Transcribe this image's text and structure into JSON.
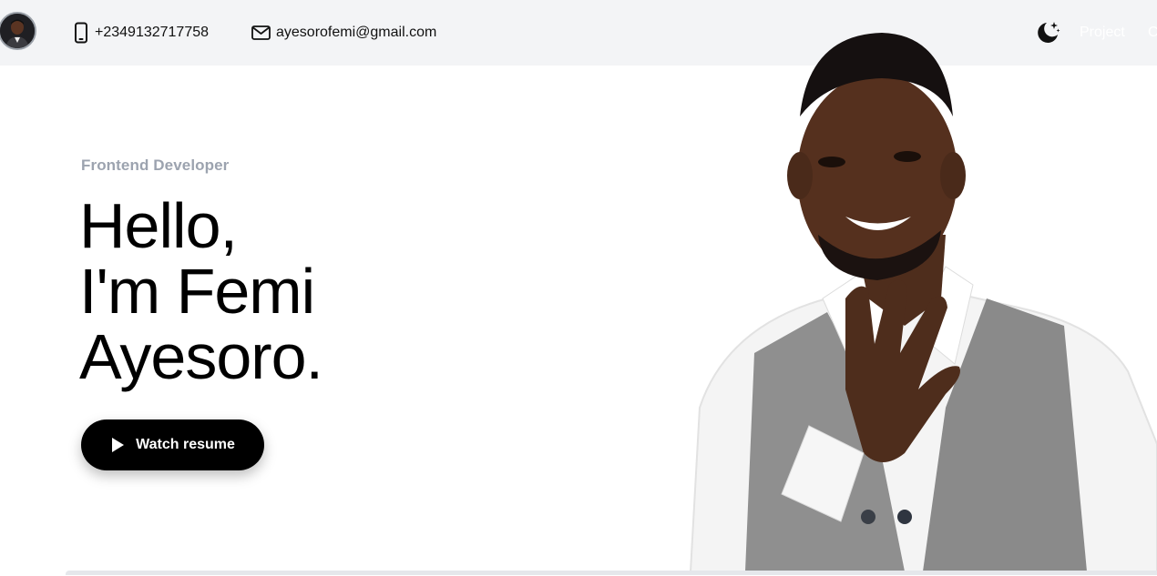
{
  "header": {
    "phone": "+2349132717758",
    "email": "ayesorofemi@gmail.com",
    "nav": [
      {
        "label": "Project"
      },
      {
        "label": "C"
      }
    ],
    "icons": {
      "avatar": "avatar",
      "phone": "phone-icon",
      "email": "mail-icon",
      "theme": "moon-stars-icon"
    }
  },
  "hero": {
    "role": "Frontend Developer",
    "headline": [
      "Hello,",
      "I'm Femi",
      "Ayesoro."
    ],
    "cta_label": "Watch resume",
    "cta_icon": "play-icon"
  },
  "colors": {
    "topbar_bg": "#f3f4f6",
    "role_text": "#9ca3af",
    "cta_bg": "#000000",
    "cta_text": "#ffffff",
    "vest": "#8d8d8d",
    "skin": "#4a2a1a"
  }
}
